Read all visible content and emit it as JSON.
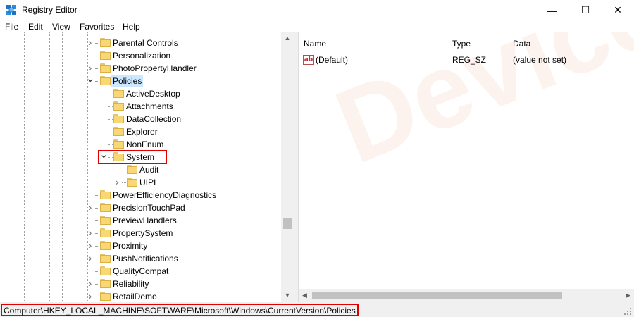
{
  "window": {
    "title": "Registry Editor",
    "icon": "regedit-icon",
    "minimize_glyph": "—",
    "maximize_glyph": "☐",
    "close_glyph": "✕"
  },
  "menu": [
    "File",
    "Edit",
    "View",
    "Favorites",
    "Help"
  ],
  "tree": {
    "nodes": [
      {
        "label": "Parental Controls",
        "expanded": false,
        "has_children": true,
        "level": 0
      },
      {
        "label": "Personalization",
        "expanded": false,
        "has_children": false,
        "level": 0
      },
      {
        "label": "PhotoPropertyHandler",
        "expanded": false,
        "has_children": true,
        "level": 0
      },
      {
        "label": "Policies",
        "expanded": true,
        "has_children": true,
        "level": 0,
        "selected": true
      },
      {
        "label": "ActiveDesktop",
        "expanded": false,
        "has_children": false,
        "level": 1
      },
      {
        "label": "Attachments",
        "expanded": false,
        "has_children": false,
        "level": 1
      },
      {
        "label": "DataCollection",
        "expanded": false,
        "has_children": false,
        "level": 1
      },
      {
        "label": "Explorer",
        "expanded": false,
        "has_children": false,
        "level": 1
      },
      {
        "label": "NonEnum",
        "expanded": false,
        "has_children": false,
        "level": 1
      },
      {
        "label": "System",
        "expanded": true,
        "has_children": true,
        "level": 1,
        "highlighted": true
      },
      {
        "label": "Audit",
        "expanded": false,
        "has_children": false,
        "level": 2
      },
      {
        "label": "UIPI",
        "expanded": false,
        "has_children": true,
        "level": 2
      },
      {
        "label": "PowerEfficiencyDiagnostics",
        "expanded": false,
        "has_children": false,
        "level": 0
      },
      {
        "label": "PrecisionTouchPad",
        "expanded": false,
        "has_children": true,
        "level": 0
      },
      {
        "label": "PreviewHandlers",
        "expanded": false,
        "has_children": false,
        "level": 0
      },
      {
        "label": "PropertySystem",
        "expanded": false,
        "has_children": true,
        "level": 0
      },
      {
        "label": "Proximity",
        "expanded": false,
        "has_children": true,
        "level": 0
      },
      {
        "label": "PushNotifications",
        "expanded": false,
        "has_children": true,
        "level": 0
      },
      {
        "label": "QualityCompat",
        "expanded": false,
        "has_children": false,
        "level": 0
      },
      {
        "label": "Reliability",
        "expanded": false,
        "has_children": true,
        "level": 0
      },
      {
        "label": "RetailDemo",
        "expanded": false,
        "has_children": true,
        "level": 0
      }
    ]
  },
  "values": {
    "columns": [
      "Name",
      "Type",
      "Data"
    ],
    "rows": [
      {
        "name": "(Default)",
        "type": "REG_SZ",
        "data": "(value not set)",
        "icon": "string-value-icon"
      }
    ]
  },
  "watermark": "DeviceTricks",
  "status_path": "Computer\\HKEY_LOCAL_MACHINE\\SOFTWARE\\Microsoft\\Windows\\CurrentVersion\\Policies",
  "colors": {
    "selection": "#cce8ff",
    "highlight_box": "#e00000",
    "folder": "#f8d775"
  }
}
